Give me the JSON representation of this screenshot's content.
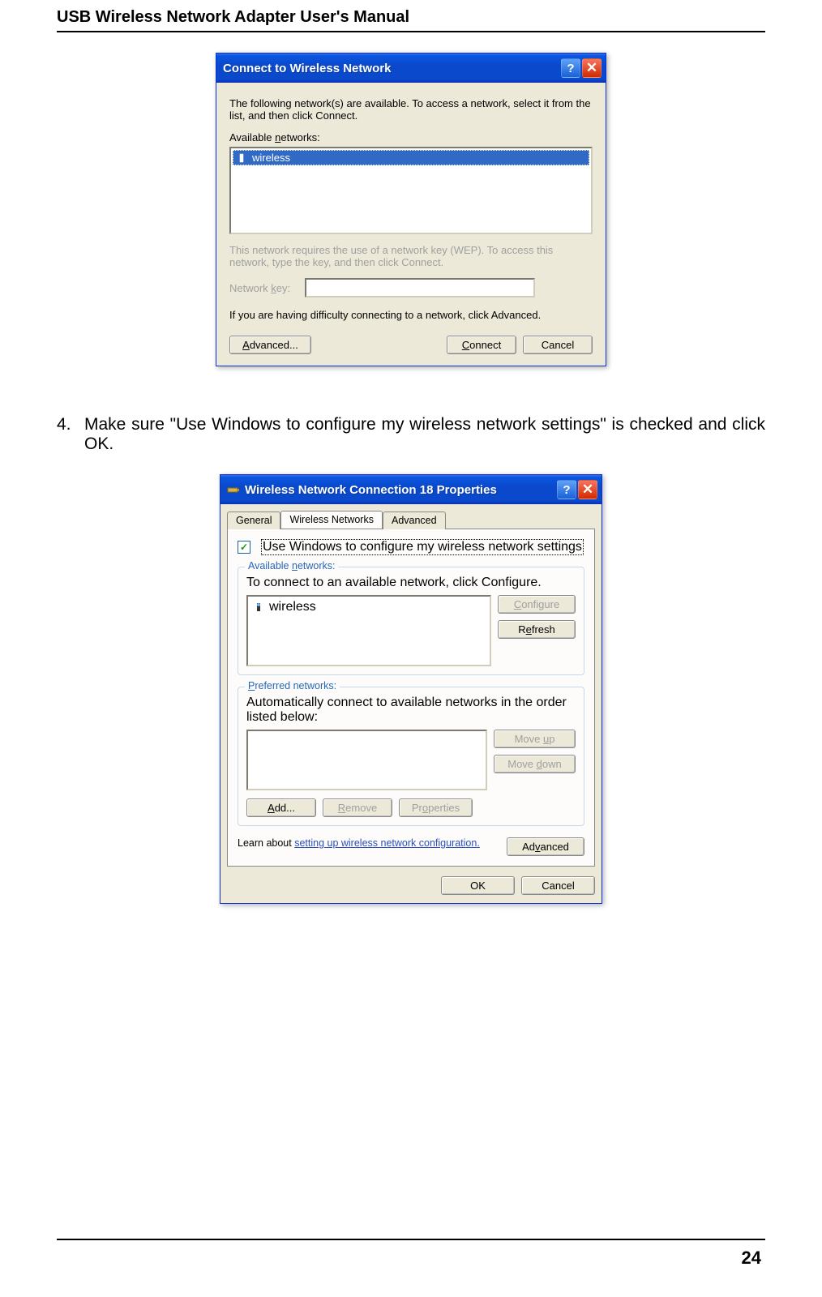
{
  "doc": {
    "header": "USB Wireless Network Adapter User's Manual",
    "page_number": "24",
    "step_num": "4.",
    "step_text": "Make sure \"Use Windows to configure my wireless network settings\" is checked and click OK."
  },
  "dialog1": {
    "title": "Connect to Wireless Network",
    "intro": "The following network(s) are available. To access a network, select it from the list, and then click Connect.",
    "available_label": "Available networks:",
    "network_item": "wireless",
    "wep_note": "This network requires the use of a network key (WEP). To access this network, type the key, and then click Connect.",
    "key_label": "Network key:",
    "advanced_hint": "If you are having difficulty connecting to a network, click Advanced.",
    "btn_advanced": "Advanced...",
    "btn_connect": "Connect",
    "btn_cancel": "Cancel",
    "help": "?",
    "close": "✕"
  },
  "dialog2": {
    "title": "Wireless Network Connection 18 Properties",
    "tabs": {
      "general": "General",
      "wireless": "Wireless Networks",
      "advanced": "Advanced"
    },
    "checkbox_label": "Use Windows to configure my wireless network settings",
    "group_available": "Available networks:",
    "available_text": "To connect to an available network, click Configure.",
    "network_item": "wireless",
    "btn_configure": "Configure",
    "btn_refresh": "Refresh",
    "group_preferred": "Preferred networks:",
    "preferred_text": "Automatically connect to available networks in the order listed below:",
    "btn_moveup": "Move up",
    "btn_movedown": "Move down",
    "btn_add": "Add...",
    "btn_remove": "Remove",
    "btn_properties": "Properties",
    "learn_prefix": "Learn about ",
    "learn_link": "setting up wireless network configuration.",
    "btn_advanced": "Advanced",
    "btn_ok": "OK",
    "btn_cancel": "Cancel",
    "help": "?",
    "close": "✕",
    "check_mark": "✓"
  }
}
